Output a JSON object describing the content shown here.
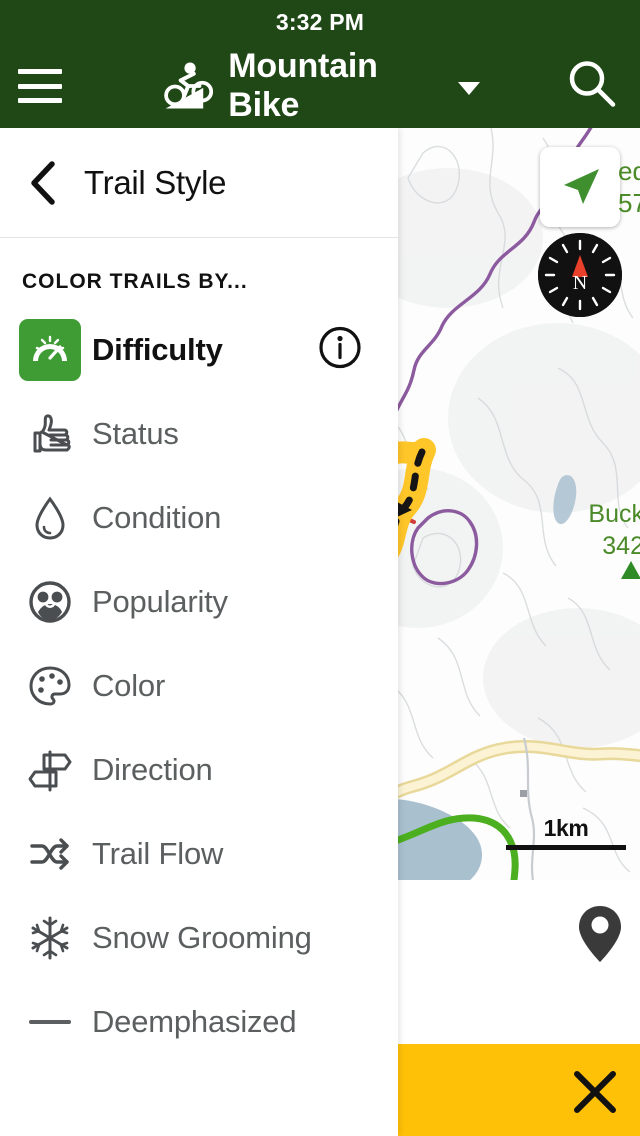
{
  "status_bar": {
    "clock": "3:32 PM"
  },
  "header": {
    "menu_icon": "hamburger-menu-icon",
    "activity_icon": "mountain-bike-icon",
    "title": "Mountain Bike",
    "dropdown_icon": "caret-down-icon",
    "search_icon": "search-icon",
    "background_color": "#204817"
  },
  "panel": {
    "back_icon": "back-chevron-icon",
    "title": "Trail Style",
    "section_label": "COLOR TRAILS BY...",
    "options": [
      {
        "label": "Difficulty",
        "icon": "speedometer-icon",
        "active": true,
        "has_info": true,
        "info_icon": "info-circle-icon",
        "accent": "#3f9c35"
      },
      {
        "label": "Status",
        "icon": "thumbs-up-icon",
        "active": false,
        "has_info": false
      },
      {
        "label": "Condition",
        "icon": "water-drop-icon",
        "active": false,
        "has_info": false
      },
      {
        "label": "Popularity",
        "icon": "people-circle-icon",
        "active": false,
        "has_info": false
      },
      {
        "label": "Color",
        "icon": "paint-palette-icon",
        "active": false,
        "has_info": false
      },
      {
        "label": "Direction",
        "icon": "signpost-icon",
        "active": false,
        "has_info": false
      },
      {
        "label": "Trail Flow",
        "icon": "shuffle-arrows-icon",
        "active": false,
        "has_info": false
      },
      {
        "label": "Snow Grooming",
        "icon": "snowflake-icon",
        "active": false,
        "has_info": false
      },
      {
        "label": "Deemphasized",
        "icon": "dash-line-icon",
        "active": false,
        "has_info": false
      }
    ]
  },
  "map": {
    "locate_icon": "location-arrow-icon",
    "compass_icon": "compass-icon",
    "compass_letter": "N",
    "scale_label": "1km",
    "peak_name": "Buck",
    "peak_elevation": "342",
    "peak_marker_icon": "peak-triangle-icon",
    "clipped_label_line1": "ed",
    "clipped_label_line2": "57",
    "pin_icon": "map-pin-icon",
    "colors": {
      "locate_arrow": "#3f8f2f",
      "peak_label": "#4a8a28",
      "trail_yellow": "#FFC629",
      "trail_green": "#4caf1f",
      "trail_red": "#d13b3b",
      "boundary_purple": "#8c5a9e",
      "water": "#a9c0cf",
      "road": "#f3e3a8"
    }
  },
  "bottom_bar": {
    "background_color": "#FFC107",
    "close_icon": "close-x-icon"
  }
}
